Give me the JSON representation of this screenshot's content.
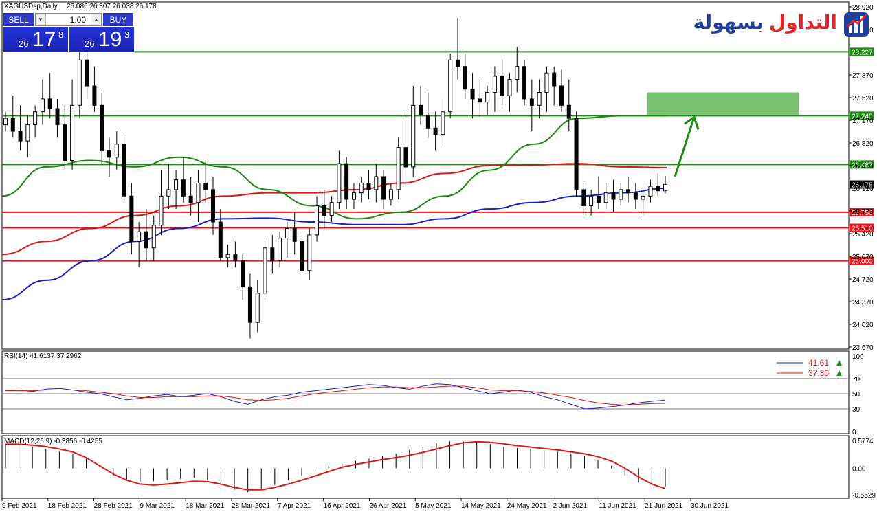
{
  "header": {
    "symbol_title": "XAGUSDsp,Daily",
    "ohlc": "26.086 26.307 26.038 26.178"
  },
  "trade_panel": {
    "sell_label": "SELL",
    "buy_label": "BUY",
    "lot": "1.00",
    "sell_price": {
      "small": "26",
      "big": "17",
      "sup": "8"
    },
    "buy_price": {
      "small": "26",
      "big": "19",
      "sup": "3"
    }
  },
  "logo": {
    "text_red": "التداول",
    "text_blue": "بسهولة"
  },
  "colors": {
    "support_line": "#e8141a",
    "resistance_line": "#1f8a14",
    "ma_short": "#1b22c4",
    "ma_mid": "#d81b14",
    "ma_long": "#1a8a0c",
    "target_box": "#78c16e",
    "arrow": "#1e8a14"
  },
  "chart_data": [
    {
      "type": "candlestick",
      "price_axis": {
        "ticks": [
          "28.920",
          "28.570",
          "27.870",
          "27.520",
          "27.170",
          "26.820",
          "26.470",
          "26.120",
          "25.770",
          "25.420",
          "25.070",
          "24.720",
          "24.370",
          "24.020",
          "23.670"
        ],
        "tick_values": [
          28.92,
          28.57,
          27.87,
          27.52,
          27.17,
          26.82,
          26.47,
          26.12,
          25.77,
          25.42,
          25.07,
          24.72,
          24.37,
          24.02,
          23.67
        ],
        "range": [
          23.67,
          28.92
        ]
      },
      "date_axis": [
        "9 Feb 2021",
        "18 Feb 2021",
        "28 Feb 2021",
        "9 Mar 2021",
        "18 Mar 2021",
        "28 Mar 2021",
        "7 Apr 2021",
        "16 Apr 2021",
        "26 Apr 2021",
        "5 May 2021",
        "14 May 2021",
        "24 May 2021",
        "2 Jun 2021",
        "11 Jun 2021",
        "21 Jun 2021",
        "30 Jun 2021"
      ],
      "horizontal_levels": [
        {
          "label": "28.227",
          "value": 28.227,
          "kind": "resistance"
        },
        {
          "label": "27.240",
          "value": 27.24,
          "kind": "resistance"
        },
        {
          "label": "26.487",
          "value": 26.487,
          "kind": "resistance"
        },
        {
          "label": "25.750",
          "value": 25.75,
          "kind": "support"
        },
        {
          "label": "25.510",
          "value": 25.51,
          "kind": "support"
        },
        {
          "label": "25.000",
          "value": 25.0,
          "kind": "support"
        }
      ],
      "current_price": {
        "label": "26.178",
        "value": 26.178
      },
      "target_zone": [
        27.24,
        27.6
      ],
      "candles": [
        [
          27.1,
          27.3,
          27.0,
          27.2
        ],
        [
          27.2,
          27.55,
          26.9,
          27.0
        ],
        [
          27.0,
          27.4,
          26.7,
          26.85
        ],
        [
          26.85,
          27.25,
          26.6,
          27.1
        ],
        [
          27.1,
          27.4,
          26.9,
          27.3
        ],
        [
          27.3,
          27.8,
          27.1,
          27.5
        ],
        [
          27.5,
          27.9,
          27.2,
          27.35
        ],
        [
          27.35,
          27.5,
          26.9,
          27.1
        ],
        [
          27.1,
          27.4,
          26.4,
          26.55
        ],
        [
          26.55,
          27.8,
          26.4,
          27.4
        ],
        [
          27.4,
          28.25,
          27.2,
          28.1
        ],
        [
          28.1,
          28.3,
          27.5,
          27.7
        ],
        [
          27.7,
          28.0,
          27.3,
          27.4
        ],
        [
          27.4,
          27.6,
          26.5,
          26.7
        ],
        [
          26.7,
          26.9,
          26.3,
          26.6
        ],
        [
          26.6,
          27.0,
          26.4,
          26.8
        ],
        [
          26.8,
          26.95,
          25.9,
          26.0
        ],
        [
          26.0,
          26.2,
          25.1,
          25.3
        ],
        [
          25.3,
          25.6,
          24.9,
          25.45
        ],
        [
          25.45,
          25.8,
          25.0,
          25.2
        ],
        [
          25.2,
          25.7,
          25.0,
          25.55
        ],
        [
          25.55,
          26.4,
          25.4,
          26.0
        ],
        [
          26.0,
          26.5,
          25.8,
          26.1
        ],
        [
          26.1,
          26.4,
          25.8,
          26.25
        ],
        [
          26.25,
          26.6,
          25.9,
          26.0
        ],
        [
          26.0,
          26.3,
          25.7,
          25.9
        ],
        [
          25.9,
          26.4,
          25.6,
          26.2
        ],
        [
          26.2,
          26.55,
          25.9,
          26.1
        ],
        [
          26.1,
          26.3,
          25.4,
          25.6
        ],
        [
          25.6,
          25.8,
          25.0,
          25.05
        ],
        [
          25.05,
          25.25,
          24.9,
          25.1
        ],
        [
          25.1,
          25.3,
          24.9,
          25.0
        ],
        [
          25.0,
          25.1,
          24.4,
          24.6
        ],
        [
          24.6,
          24.8,
          23.8,
          24.05
        ],
        [
          24.05,
          24.7,
          23.9,
          24.5
        ],
        [
          24.5,
          25.3,
          24.4,
          25.2
        ],
        [
          25.2,
          25.4,
          24.8,
          25.0
        ],
        [
          25.0,
          25.45,
          24.9,
          25.35
        ],
        [
          25.35,
          25.6,
          25.05,
          25.5
        ],
        [
          25.5,
          25.75,
          25.1,
          25.3
        ],
        [
          25.3,
          25.4,
          24.7,
          24.85
        ],
        [
          24.85,
          25.5,
          24.7,
          25.4
        ],
        [
          25.4,
          26.0,
          25.3,
          25.85
        ],
        [
          25.85,
          26.1,
          25.5,
          25.7
        ],
        [
          25.7,
          26.0,
          25.6,
          25.9
        ],
        [
          25.9,
          26.7,
          25.8,
          26.5
        ],
        [
          26.5,
          26.6,
          25.8,
          25.95
        ],
        [
          25.95,
          26.2,
          25.8,
          26.05
        ],
        [
          26.05,
          26.3,
          25.9,
          26.2
        ],
        [
          26.2,
          26.4,
          25.95,
          26.1
        ],
        [
          26.1,
          26.5,
          25.9,
          26.3
        ],
        [
          26.3,
          26.4,
          25.8,
          25.95
        ],
        [
          25.95,
          26.2,
          25.85,
          26.1
        ],
        [
          26.1,
          26.9,
          25.95,
          26.75
        ],
        [
          26.75,
          27.3,
          26.2,
          26.45
        ],
        [
          26.45,
          27.7,
          26.3,
          27.4
        ],
        [
          27.4,
          27.7,
          27.1,
          27.25
        ],
        [
          27.25,
          27.6,
          26.9,
          27.05
        ],
        [
          27.05,
          27.3,
          26.7,
          26.95
        ],
        [
          26.95,
          27.5,
          26.8,
          27.3
        ],
        [
          27.3,
          28.2,
          27.2,
          28.1
        ],
        [
          28.1,
          28.75,
          27.8,
          28.0
        ],
        [
          28.0,
          28.2,
          27.5,
          27.65
        ],
        [
          27.65,
          27.9,
          27.2,
          27.5
        ],
        [
          27.5,
          27.8,
          27.2,
          27.45
        ],
        [
          27.45,
          27.7,
          27.25,
          27.6
        ],
        [
          27.6,
          28.0,
          27.3,
          27.85
        ],
        [
          27.85,
          28.1,
          27.4,
          27.55
        ],
        [
          27.55,
          27.9,
          27.3,
          27.8
        ],
        [
          27.8,
          28.3,
          27.6,
          28.0
        ],
        [
          28.0,
          28.1,
          27.4,
          27.5
        ],
        [
          27.5,
          27.8,
          27.0,
          27.4
        ],
        [
          27.4,
          27.8,
          27.2,
          27.6
        ],
        [
          27.6,
          28.0,
          27.3,
          27.9
        ],
        [
          27.9,
          28.0,
          27.4,
          27.7
        ],
        [
          27.7,
          27.95,
          27.3,
          27.4
        ],
        [
          27.4,
          27.8,
          27.0,
          27.2
        ],
        [
          27.2,
          27.3,
          26.0,
          26.1
        ],
        [
          26.1,
          26.2,
          25.7,
          25.85
        ],
        [
          25.85,
          26.1,
          25.7,
          26.0
        ],
        [
          26.0,
          26.3,
          25.8,
          25.9
        ],
        [
          25.9,
          26.2,
          25.8,
          26.05
        ],
        [
          26.05,
          26.25,
          25.75,
          25.95
        ],
        [
          25.95,
          26.2,
          25.85,
          26.1
        ],
        [
          26.1,
          26.3,
          25.9,
          26.05
        ],
        [
          26.05,
          26.2,
          25.8,
          25.95
        ],
        [
          25.95,
          26.1,
          25.7,
          26.0
        ],
        [
          26.0,
          26.25,
          25.9,
          26.15
        ],
        [
          26.15,
          26.35,
          26.0,
          26.08
        ],
        [
          26.08,
          26.31,
          26.04,
          26.18
        ]
      ],
      "moving_averages": [
        {
          "color": "blue",
          "values": [
            24.4,
            24.7,
            25.0,
            25.3,
            25.5,
            25.65,
            25.66,
            25.6,
            25.56,
            25.56,
            25.65,
            25.8,
            25.9,
            26.0,
            26.05,
            26.12
          ]
        },
        {
          "color": "red",
          "values": [
            25.1,
            25.3,
            25.5,
            25.7,
            25.85,
            26.0,
            26.05,
            26.05,
            26.1,
            26.2,
            26.35,
            26.47,
            26.48,
            26.5,
            26.45,
            26.44
          ]
        },
        {
          "color": "green",
          "values": [
            26.0,
            26.45,
            26.55,
            26.45,
            26.6,
            26.45,
            26.1,
            25.85,
            25.65,
            25.75,
            26.0,
            26.4,
            26.8,
            27.2,
            27.24,
            27.24
          ]
        }
      ]
    },
    {
      "type": "line",
      "title": "RSI(14) 41.6137 37.2962",
      "y_ticks": [
        "100",
        "70",
        "50",
        "30",
        "0"
      ],
      "ylim": [
        0,
        100
      ],
      "legend": [
        "41.61",
        "37.30"
      ],
      "series": [
        {
          "name": "41.61",
          "color": "blue",
          "values": [
            54,
            55,
            53,
            56,
            57,
            55,
            52,
            50,
            46,
            42,
            44,
            47,
            49,
            46,
            48,
            50,
            46,
            40,
            36,
            42,
            46,
            48,
            52,
            54,
            56,
            58,
            60,
            62,
            61,
            58,
            56,
            60,
            63,
            62,
            58,
            54,
            50,
            52,
            55,
            52,
            46,
            42,
            36,
            30,
            31,
            33,
            35,
            38,
            40,
            41.6
          ]
        },
        {
          "name": "37.30",
          "color": "red",
          "values": [
            54,
            54,
            54,
            55,
            55,
            55,
            54,
            52,
            50,
            47,
            45,
            45,
            46,
            46,
            46,
            47,
            47,
            45,
            42,
            41,
            42,
            44,
            47,
            50,
            52,
            54,
            56,
            58,
            59,
            59,
            58,
            58,
            59,
            60,
            60,
            58,
            55,
            54,
            54,
            53,
            51,
            48,
            45,
            41,
            38,
            36,
            35,
            36,
            37,
            37.3
          ]
        }
      ]
    },
    {
      "type": "bar",
      "title": "MACD(12,26,9) -0.3856 -0.4255",
      "y_ticks": [
        "0.5774",
        "0.00",
        "-0.5529"
      ],
      "ylim": [
        -0.5529,
        0.5774
      ],
      "histogram": [
        0.5,
        0.48,
        0.45,
        0.4,
        0.35,
        0.3,
        0.2,
        0.0,
        -0.15,
        -0.25,
        -0.28,
        -0.27,
        -0.25,
        -0.22,
        -0.2,
        -0.25,
        -0.35,
        -0.45,
        -0.5,
        -0.45,
        -0.35,
        -0.25,
        -0.15,
        -0.05,
        0.05,
        0.1,
        0.15,
        0.2,
        0.25,
        0.3,
        0.38,
        0.45,
        0.52,
        0.56,
        0.56,
        0.54,
        0.5,
        0.45,
        0.42,
        0.4,
        0.38,
        0.35,
        0.3,
        0.25,
        0.18,
        0.05,
        -0.15,
        -0.3,
        -0.38,
        -0.386
      ],
      "signal": [
        0.5,
        0.5,
        0.48,
        0.45,
        0.4,
        0.34,
        0.22,
        0.05,
        -0.12,
        -0.25,
        -0.33,
        -0.35,
        -0.33,
        -0.3,
        -0.27,
        -0.28,
        -0.33,
        -0.4,
        -0.45,
        -0.45,
        -0.4,
        -0.33,
        -0.25,
        -0.16,
        -0.07,
        0.02,
        0.08,
        0.13,
        0.18,
        0.22,
        0.27,
        0.33,
        0.4,
        0.47,
        0.53,
        0.55,
        0.54,
        0.51,
        0.47,
        0.44,
        0.41,
        0.38,
        0.34,
        0.3,
        0.24,
        0.15,
        0.0,
        -0.18,
        -0.33,
        -0.4255
      ]
    }
  ]
}
